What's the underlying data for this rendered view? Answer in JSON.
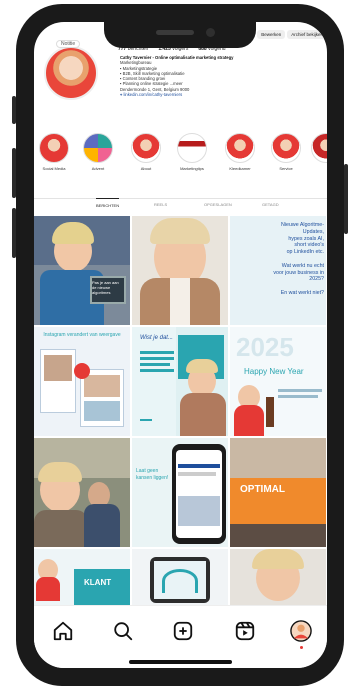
{
  "profile": {
    "badge": "Notitie",
    "stats": [
      {
        "count": "777",
        "label": "berichten"
      },
      {
        "count": "1.425",
        "label": "volgers"
      },
      {
        "count": "888",
        "label": "volgend"
      }
    ],
    "buttons": [
      "Bewerken",
      "Archief bekijken"
    ],
    "bio": [
      "Cathy Tavernier - Online optimalisatie marketing strategy",
      "Marketingbureau",
      "▪ Marketingstrategie",
      "▪ B2B, Skill marketing optimalisatie",
      "▪ Content branding groei",
      "▪ Planning online strategie ...meer",
      "Dendermonde 1, Gent, Belgium 9000",
      "⌖ linkedin.com/in/cathy-taverniers"
    ]
  },
  "highlights": [
    {
      "label": "Social Media",
      "color": "#e53935"
    },
    {
      "label": "Advent",
      "color": "#2aa59a"
    },
    {
      "label": "About",
      "color": "#e53935"
    },
    {
      "label": "Marketingtips",
      "color": "#b71c1c"
    },
    {
      "label": "Kleedkamer",
      "color": "#e53935"
    },
    {
      "label": "Service",
      "color": "#e53935"
    },
    {
      "label": "",
      "color": "#c62828"
    }
  ],
  "tabs": [
    {
      "label": "BERICHTEN",
      "active": true
    },
    {
      "label": "REELS",
      "active": false
    },
    {
      "label": "OPGESLAGEN",
      "active": false
    },
    {
      "label": "GETAGD",
      "active": false
    }
  ],
  "posts": {
    "p1_caption": "Pas je aan aan de nieuwe algoritmes",
    "p3_lines": [
      "Nieuwe Algoritme-",
      "Updates,",
      "hypes zoals AI,",
      "short video's",
      "op LinkedIn etc.",
      "",
      "Wat werkt nu echt",
      "voor jouw business in",
      "2025?",
      "",
      "En wat werkt niet?"
    ],
    "p4_title": "Instagram verandert van weergave",
    "p5_title": "Wist je dat...",
    "p6_year": "2025",
    "p6_greeting": "Happy New Year",
    "p7_title": "Laat geen kansen liggen!",
    "p8_title": "OPTIMAL",
    "p10_title": "KLANT"
  },
  "colors": {
    "accent": "#e53935",
    "teal": "#2aa5b0",
    "navy": "#1e4e9c",
    "link": "#1e4e9c"
  },
  "nav": [
    {
      "icon": "home-icon"
    },
    {
      "icon": "search-icon"
    },
    {
      "icon": "add-post-icon"
    },
    {
      "icon": "reels-icon"
    },
    {
      "icon": "profile-avatar"
    }
  ]
}
